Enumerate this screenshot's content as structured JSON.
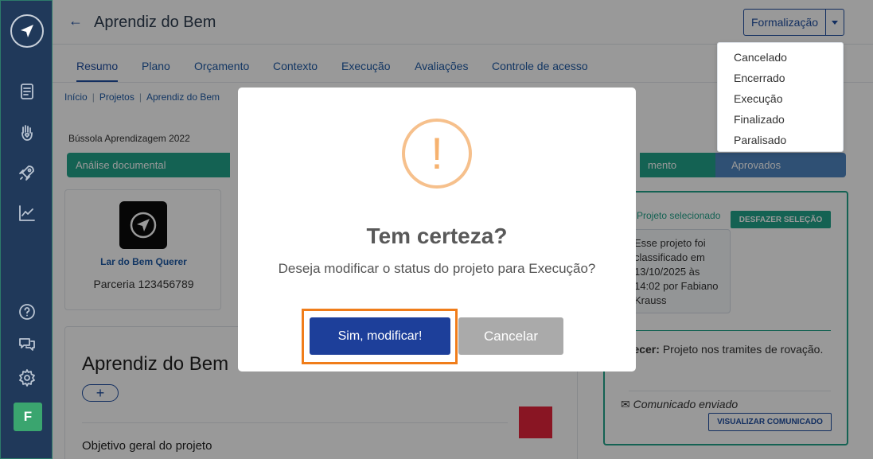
{
  "app": {
    "title": "Aprendiz do Bem",
    "back_icon": "arrow-left-icon"
  },
  "sidebar": {
    "items": [
      {
        "icon": "document-icon"
      },
      {
        "icon": "hand-heart-icon"
      },
      {
        "icon": "rocket-icon"
      },
      {
        "icon": "chart-line-icon"
      },
      {
        "icon": "help-icon"
      },
      {
        "icon": "chat-icon"
      },
      {
        "icon": "settings-icon"
      }
    ],
    "user_initial": "F",
    "user_color": "#3aa56f"
  },
  "header": {
    "formalization_label": "Formalização"
  },
  "tabs": [
    {
      "label": "Resumo",
      "active": true
    },
    {
      "label": "Plano"
    },
    {
      "label": "Orçamento"
    },
    {
      "label": "Contexto"
    },
    {
      "label": "Execução"
    },
    {
      "label": "Avaliações"
    },
    {
      "label": "Controle de acesso"
    }
  ],
  "breadcrumb": [
    "Início",
    "Projetos",
    "Aprendiz do Bem"
  ],
  "program": "Bússola Aprendizagem 2022",
  "steps": {
    "first": "Análise documental",
    "partial": "mento",
    "last": "Aprovados"
  },
  "organization": {
    "name": "Lar do Bem Querer",
    "partnership": "Parceria 123456789"
  },
  "project": {
    "title": "Aprendiz do Bem",
    "add_label": "+",
    "objective_label": "Objetivo geral do projeto"
  },
  "right_panel": {
    "selected_label": "Projeto selecionado",
    "undo_label": "DESFAZER SELEÇÃO",
    "classification_text": "Esse projeto foi classificado em 13/10/2025 às 14:02 por Fabiano Krauss",
    "parecer_label": "recer:",
    "parecer_text": "Projeto nos tramites de rovação.",
    "comunicado_label": "Comunicado enviado",
    "view_label": "VISUALIZAR COMUNICADO"
  },
  "dropdown": {
    "items": [
      "Cancelado",
      "Encerrado",
      "Execução",
      "Finalizado",
      "Paralisado"
    ]
  },
  "modal": {
    "icon": "!",
    "title": "Tem certeza?",
    "message": "Deseja modificar o status do projeto para Execução?",
    "confirm_label": "Sim, modificar!",
    "cancel_label": "Cancelar"
  },
  "colors": {
    "accent": "#1f4ea0",
    "green": "#22a38a",
    "highlight": "#f07d1a"
  }
}
